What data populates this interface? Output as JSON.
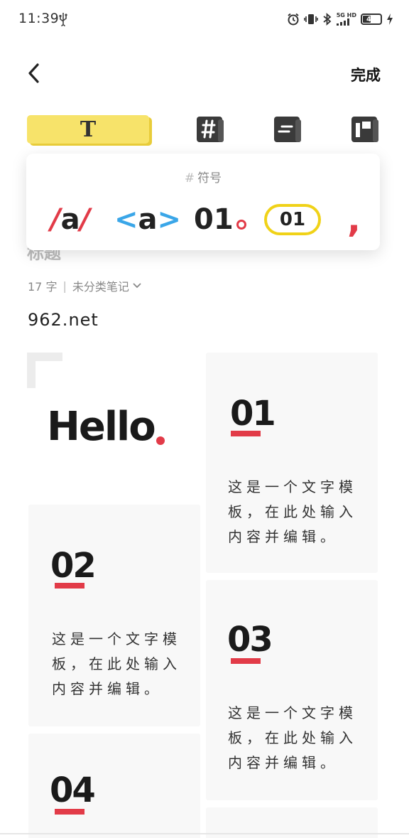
{
  "status_bar": {
    "time": "11:39",
    "network": "5G HD",
    "battery": "44"
  },
  "nav": {
    "done_label": "完成"
  },
  "toolbar": {
    "text_tool_label": "T"
  },
  "symbol_panel": {
    "title": "符号",
    "title_icon": "#",
    "symbols": {
      "slash_left": "/",
      "slash_mid": "a",
      "slash_right": "/",
      "angle_left": "<",
      "angle_mid": "a",
      "angle_right": ">",
      "dot_num": "01",
      "pill_num": "01",
      "comma": ","
    }
  },
  "note": {
    "title_placeholder": "标题",
    "word_count": "17 字",
    "category": "未分类笔记",
    "body": "962.net"
  },
  "template": {
    "hello": "Hello",
    "cards": [
      {
        "number": "01",
        "text": "这是一个文字模板，在此处输入内容并编辑。"
      },
      {
        "number": "02",
        "text": "这是一个文字模板，在此处输入内容并编辑。"
      },
      {
        "number": "03",
        "text": "这是一个文字模板，在此处输入内容并编辑。"
      },
      {
        "number": "04",
        "text": ""
      }
    ]
  },
  "colors": {
    "accent_red": "#e23b48",
    "accent_yellow": "#f7e36a",
    "accent_blue": "#3aa6e8"
  }
}
